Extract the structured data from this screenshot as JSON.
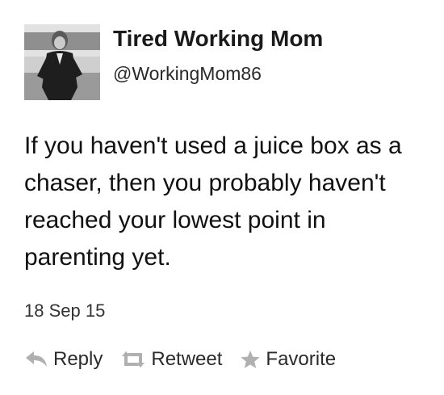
{
  "tweet": {
    "display_name": "Tired Working Mom",
    "handle": "@WorkingMom86",
    "text_lines": [
      "If you haven't used a juice box as a",
      "chaser, then you probably haven't",
      "reached your lowest point in",
      "parenting yet."
    ],
    "timestamp": "18 Sep 15"
  },
  "actions": {
    "reply": {
      "label": "Reply",
      "icon": "reply-arrow-icon"
    },
    "retweet": {
      "label": "Retweet",
      "icon": "retweet-icon"
    },
    "favorite": {
      "label": "Favorite",
      "icon": "star-icon"
    }
  },
  "colors": {
    "text": "#111111",
    "icon": "#b0b0b0",
    "background": "#ffffff"
  }
}
